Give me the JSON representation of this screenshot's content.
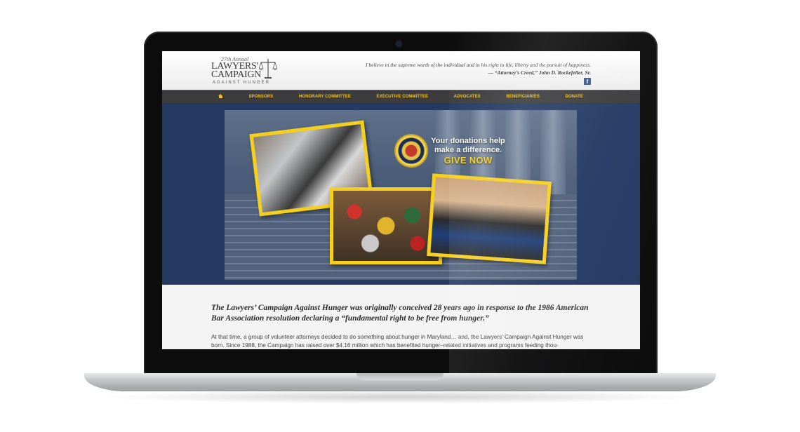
{
  "logo": {
    "annual": "27th Annual",
    "line1": "LAWYERS'",
    "line2": "CAMPAIGN",
    "line3": "AGAINST HUNGER"
  },
  "header": {
    "quote": "I believe in the supreme worth of the individual and in his right to life, liberty and the pursuit of happiness.",
    "attribution": "— “Attorney’s Creed,” John D. Rockefeller, Sr."
  },
  "nav": {
    "items": [
      "SPONSORS",
      "HONORARY COMMITTEE",
      "EXECUTIVE COMMITTEE",
      "ADVOCATES",
      "BENEFICIARIES",
      "DONATE"
    ]
  },
  "hero": {
    "cta_line1": "Your donations help",
    "cta_line2": "make a difference.",
    "cta_give": "GIVE NOW"
  },
  "content": {
    "lead": "The Lawyers’ Campaign Against Hunger was originally conceived 28 years ago in response to the 1986 American Bar Association resolution declaring a “fundamental right to be free from hunger.”",
    "body": "At that time, a group of volunteer attorneys decided to do something about hunger in Maryland… and, the Lawyers’ Campaign Against Hunger was born. Since 1988, the Campaign has raised over $4.16 million which has benefited hunger–related initiatives and programs feeding thou-"
  },
  "colors": {
    "nav_accent": "#f2c11f",
    "banner_blue": "#243a63",
    "nav_bg": "#3c3c3e"
  }
}
